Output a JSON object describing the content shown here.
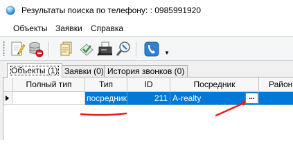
{
  "window": {
    "title": "Результаты поиска по телефону: : 0985991920"
  },
  "menu": {
    "items": [
      {
        "label": "Объекты"
      },
      {
        "label": "Заявки"
      },
      {
        "label": "Справка"
      }
    ]
  },
  "toolbar": {
    "buttons": [
      {
        "icon": "new-document-icon"
      },
      {
        "icon": "delete-database-icon"
      },
      {
        "icon": "documents-icon"
      },
      {
        "icon": "check-stamp-icon"
      },
      {
        "icon": "fax-icon"
      },
      {
        "icon": "search-phone-icon"
      },
      {
        "icon": "phone-icon"
      }
    ]
  },
  "tabs": [
    {
      "label": "Объекты (1)",
      "active": true
    },
    {
      "label": "Заявки (0)",
      "active": false
    },
    {
      "label": "История звонков (0)",
      "active": false
    }
  ],
  "grid": {
    "columns": [
      "Полный тип",
      "Тип",
      "ID",
      "Посредник",
      "Район"
    ],
    "rows": [
      {
        "full_type": "",
        "type": "посредник",
        "id": "211",
        "intermediary": "A-realty",
        "district": ""
      }
    ],
    "ellipsis_label": "..."
  },
  "colors": {
    "selection": "#0078d7",
    "annotation": "#e81c1c",
    "window_bg": "#f0f0f0"
  }
}
